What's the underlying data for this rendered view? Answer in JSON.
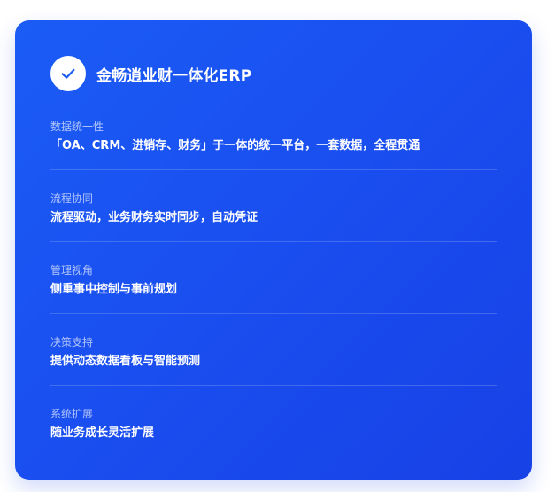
{
  "card": {
    "title": "金畅逍业财一体化ERP",
    "icon": "check-icon",
    "accent_color": "#1a4ff0"
  },
  "features": [
    {
      "label": "数据统一性",
      "desc": "「OA、CRM、进销存、财务」于一体的统一平台，一套数据，全程贯通"
    },
    {
      "label": "流程协同",
      "desc": "流程驱动，业务财务实时同步，自动凭证"
    },
    {
      "label": "管理视角",
      "desc": "侧重事中控制与事前规划"
    },
    {
      "label": "决策支持",
      "desc": "提供动态数据看板与智能预测"
    },
    {
      "label": "系统扩展",
      "desc": "随业务成长灵活扩展"
    }
  ]
}
